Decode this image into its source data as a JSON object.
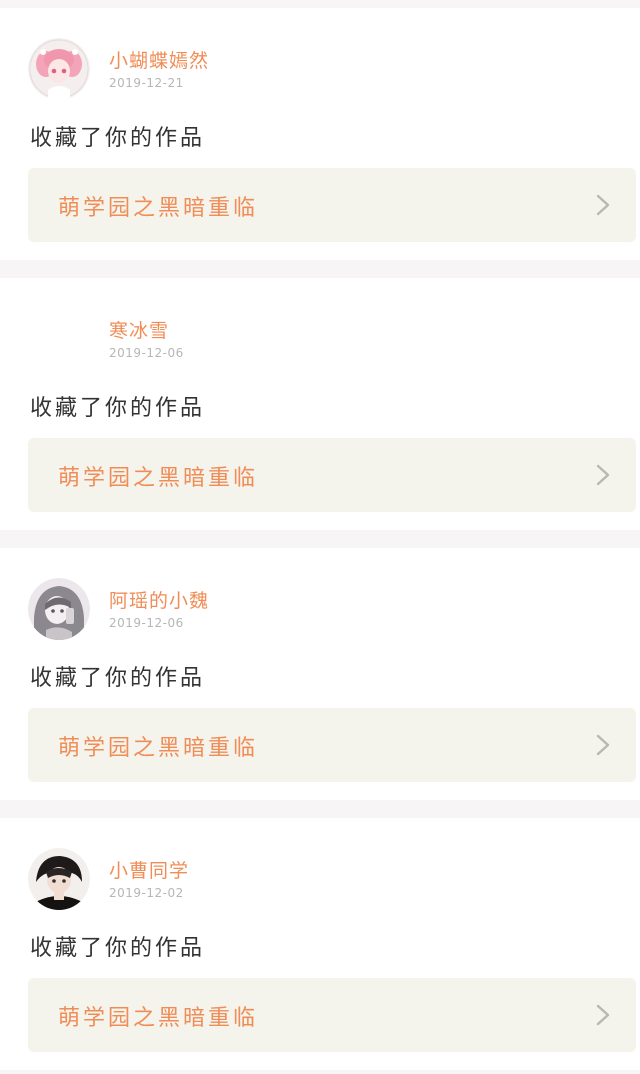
{
  "theme": {
    "accent": "#f08d57",
    "chevron": "#b9b7b2"
  },
  "activities": [
    {
      "user": "小蝴蝶嫣然",
      "date": "2019-12-21",
      "avatar_icon": "pink-anime-girl-avatar",
      "action": "收藏了你的作品",
      "work_title": "萌学园之黑暗重临"
    },
    {
      "user": "寒冰雪",
      "date": "2019-12-06",
      "avatar_icon": "blank-avatar",
      "action": "收藏了你的作品",
      "work_title": "萌学园之黑暗重临"
    },
    {
      "user": "阿瑶的小魏",
      "date": "2019-12-06",
      "avatar_icon": "grey-anime-girl-avatar",
      "action": "收藏了你的作品",
      "work_title": "萌学园之黑暗重临"
    },
    {
      "user": "小曹同学",
      "date": "2019-12-02",
      "avatar_icon": "dark-anime-boy-avatar",
      "action": "收藏了你的作品",
      "work_title": "萌学园之黑暗重临"
    }
  ]
}
